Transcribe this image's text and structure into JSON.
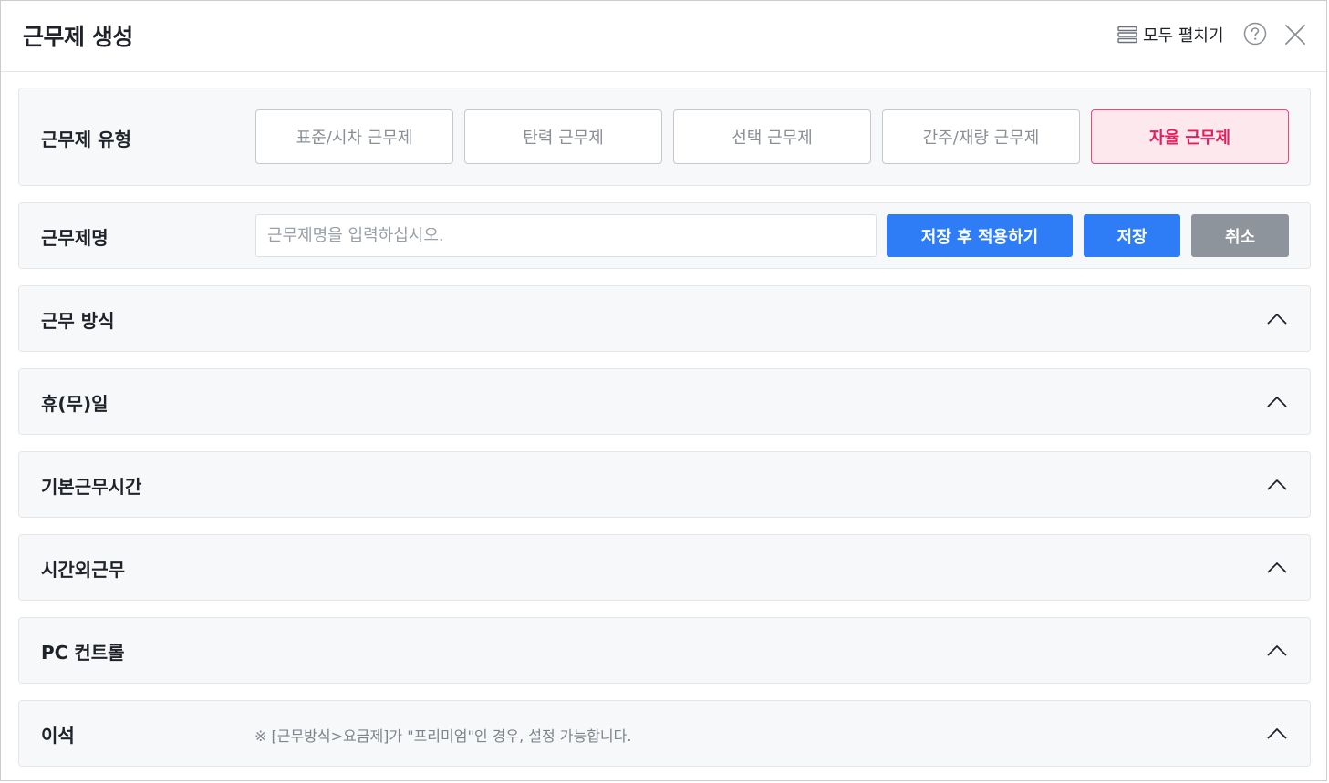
{
  "dialog": {
    "title": "근무제 생성",
    "expand_all_label": "모두 펼치기"
  },
  "work_type": {
    "label": "근무제 유형",
    "options": [
      {
        "label": "표준/시차 근무제",
        "selected": false
      },
      {
        "label": "탄력 근무제",
        "selected": false
      },
      {
        "label": "선택 근무제",
        "selected": false
      },
      {
        "label": "간주/재량 근무제",
        "selected": false
      },
      {
        "label": "자율 근무제",
        "selected": true
      }
    ]
  },
  "work_name": {
    "label": "근무제명",
    "value": "",
    "placeholder": "근무제명을 입력하십시오.",
    "save_apply_label": "저장 후 적용하기",
    "save_label": "저장",
    "cancel_label": "취소"
  },
  "sections": [
    {
      "label": "근무 방식",
      "expanded": false
    },
    {
      "label": "휴(무)일",
      "expanded": false
    },
    {
      "label": "기본근무시간",
      "expanded": false
    },
    {
      "label": "시간외근무",
      "expanded": false
    },
    {
      "label": "PC 컨트롤",
      "expanded": false
    },
    {
      "label": "이석",
      "expanded": false,
      "note": "※ [근무방식>요금제]가 \"프리미엄\"인 경우, 설정 가능합니다."
    }
  ],
  "colors": {
    "primary": "#2e7cf6",
    "selected_border": "#e84a7a",
    "selected_bg": "#fde8ee",
    "selected_text": "#e3205e",
    "cancel": "#8e949b"
  }
}
